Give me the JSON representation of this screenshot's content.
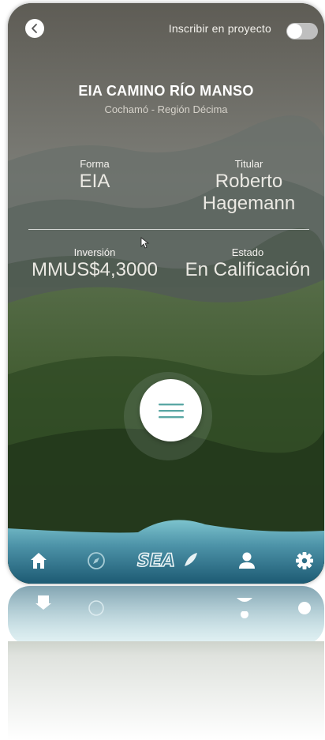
{
  "top_bar": {
    "enroll_label": "Inscribir en proyecto",
    "toggle_on": false
  },
  "project": {
    "title": "EIA CAMINO RÍO MANSO",
    "subtitle": "Cochamó - Región Décima",
    "forma": {
      "label": "Forma",
      "value": "EIA"
    },
    "titular": {
      "label": "Titular",
      "value_line1": "Roberto",
      "value_line2": "Hagemann"
    },
    "inversion": {
      "label": "Inversión",
      "value": "MMUS$4,3000"
    },
    "estado": {
      "label": "Estado",
      "value": "En Calificación"
    }
  },
  "bottom_nav": {
    "logo_text": "SEA",
    "items": [
      "home-icon",
      "compass-icon",
      "sea-logo",
      "user-icon",
      "gear-icon"
    ]
  },
  "colors": {
    "nav_top": "#6fb3c2",
    "nav_bottom": "#1f5f78",
    "accent": "#5aa7a4"
  }
}
